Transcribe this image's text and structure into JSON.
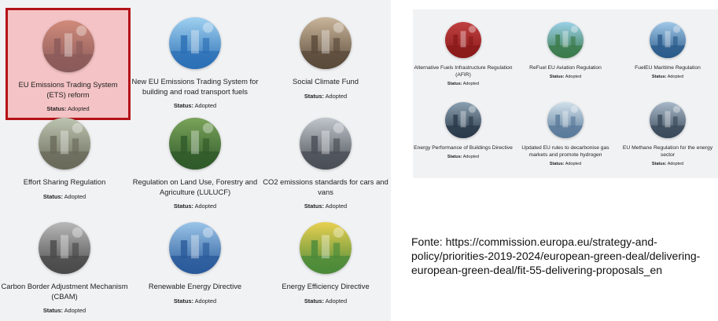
{
  "status_label": "Status:",
  "left_cards": [
    {
      "title": "EU Emissions Trading System (ETS) reform",
      "status": "Adopted",
      "image": "power-plant-icon",
      "colors": [
        "#8a5a5a",
        "#d08a7a"
      ]
    },
    {
      "title": "New EU Emissions Trading System for building and road transport fuels",
      "status": "Adopted",
      "image": "fuel-station-icon",
      "colors": [
        "#2b6fb5",
        "#9fd0f0"
      ]
    },
    {
      "title": "Social Climate Fund",
      "status": "Adopted",
      "image": "elderly-people-icon",
      "colors": [
        "#5a4a3a",
        "#c9b59a"
      ]
    },
    {
      "title": "Effort Sharing Regulation",
      "status": "Adopted",
      "image": "cooling-tower-icon",
      "colors": [
        "#6a6a5a",
        "#bcc4b0"
      ]
    },
    {
      "title": "Regulation on Land Use, Forestry and Agriculture (LULUCF)",
      "status": "Adopted",
      "image": "forest-field-icon",
      "colors": [
        "#2f5a2a",
        "#7aa35a"
      ]
    },
    {
      "title": "CO2 emissions standards for cars and vans",
      "status": "Adopted",
      "image": "cars-traffic-icon",
      "colors": [
        "#4a4e55",
        "#c0c6cc"
      ]
    },
    {
      "title": "Carbon Border Adjustment Mechanism (CBAM)",
      "status": "Adopted",
      "image": "steel-industry-icon",
      "colors": [
        "#4a4a4a",
        "#b8b8b8"
      ]
    },
    {
      "title": "Renewable Energy Directive",
      "status": "Adopted",
      "image": "solar-wind-icon",
      "colors": [
        "#2a5a9a",
        "#9ac4e8"
      ]
    },
    {
      "title": "Energy Efficiency Directive",
      "status": "Adopted",
      "image": "energy-label-icon",
      "colors": [
        "#4a8a3a",
        "#e8d050"
      ]
    }
  ],
  "right_cards": [
    {
      "title": "Alternative Fuels Infrastructure Regulation (AFIR)",
      "status": "Adopted",
      "image": "ev-charger-icon",
      "colors": [
        "#8a1a1a",
        "#c04040"
      ]
    },
    {
      "title": "ReFuel EU Aviation Regulation",
      "status": "Adopted",
      "image": "airplane-icon",
      "colors": [
        "#3a7a4a",
        "#9ad0e8"
      ]
    },
    {
      "title": "FuelEU Maritime Regulation",
      "status": "Adopted",
      "image": "cargo-ship-icon",
      "colors": [
        "#2a5a8a",
        "#a0c8e8"
      ]
    },
    {
      "title": "Energy Performance of Buildings Directive",
      "status": "Adopted",
      "image": "building-facade-icon",
      "colors": [
        "#2a3a4a",
        "#8aa0b0"
      ]
    },
    {
      "title": "Updated EU rules to decarbonise gas markets and promote hydrogen",
      "status": "Adopted",
      "image": "hydrogen-tanks-icon",
      "colors": [
        "#5a7a9a",
        "#d0e0ea"
      ]
    },
    {
      "title": "EU Methane Regulation for the energy sector",
      "status": "Adopted",
      "image": "pipeline-icon",
      "colors": [
        "#3a4a5a",
        "#a8b8c8"
      ]
    }
  ],
  "source_note": "Fonte: https://commission.europa.eu/strategy-and-policy/priorities-2019-2024/european-green-deal/delivering-european-green-deal/fit-55-delivering-proposals_en"
}
